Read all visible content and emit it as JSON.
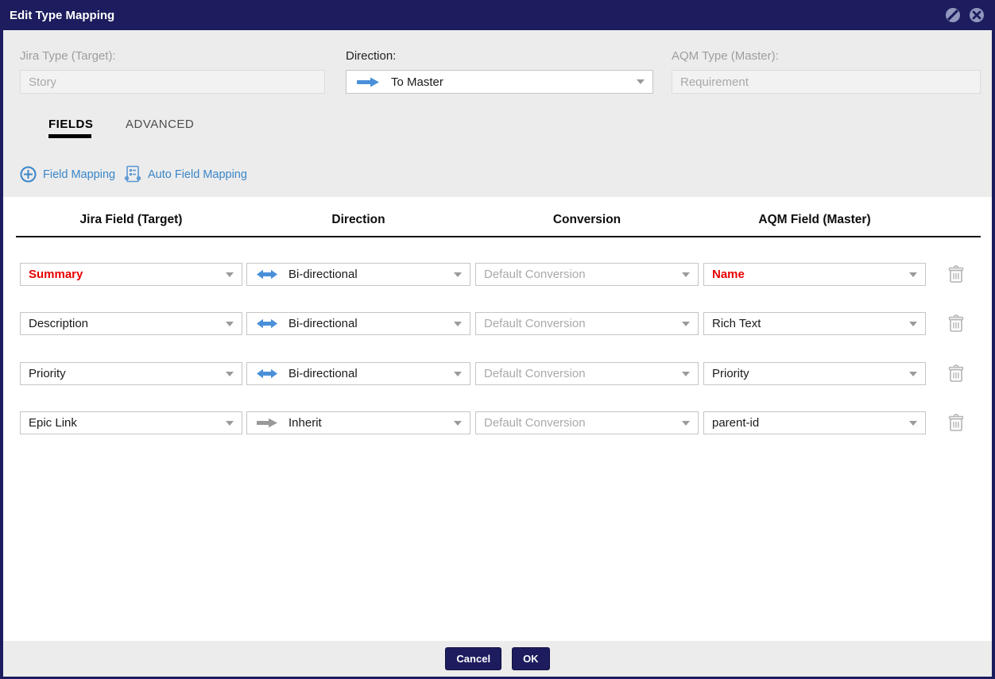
{
  "title_bar": {
    "title": "Edit Type Mapping",
    "icons": [
      "disable-circle-icon",
      "close-circle-icon"
    ]
  },
  "form": {
    "jira_type_label": "Jira Type (Target):",
    "jira_type_value": "Story",
    "direction_label": "Direction:",
    "direction_value": "To Master",
    "aqm_type_label": "AQM Type (Master):",
    "aqm_type_value": "Requirement"
  },
  "tabs": {
    "fields_label": "FIELDS",
    "advanced_label": "ADVANCED",
    "active_tab": "FIELDS"
  },
  "toolbar": {
    "field_mapping_label": "Field Mapping",
    "field_mapping_icon": "plus-circle-icon",
    "auto_field_mapping_label": "Auto Field Mapping",
    "auto_field_mapping_icon": "auto-mapping-document-icon"
  },
  "table": {
    "headers": {
      "jira_field": "Jira Field (Target)",
      "direction": "Direction",
      "conversion": "Conversion",
      "aqm_field": "AQM Field (Master)"
    },
    "rows": [
      {
        "jira_field": "Summary",
        "direction": "Bi-directional",
        "direction_type": "bi-directional",
        "conversion": "Default Conversion",
        "aqm_field": "Name",
        "highlighted": true
      },
      {
        "jira_field": "Description",
        "direction": "Bi-directional",
        "direction_type": "bi-directional",
        "conversion": "Default Conversion",
        "aqm_field": "Rich Text",
        "highlighted": false
      },
      {
        "jira_field": "Priority",
        "direction": "Bi-directional",
        "direction_type": "bi-directional",
        "conversion": "Default Conversion",
        "aqm_field": "Priority",
        "highlighted": false
      },
      {
        "jira_field": "Epic Link",
        "direction": "Inherit",
        "direction_type": "inherit",
        "conversion": "Default Conversion",
        "aqm_field": "parent-id",
        "highlighted": false
      }
    ],
    "row_action_icon": "trash-icon"
  },
  "footer": {
    "cancel_label": "Cancel",
    "ok_label": "OK"
  },
  "colors": {
    "title_bar_navy": "#1c1c5e",
    "accent_link_blue": "#3a86c8",
    "direction_arrow_blue": "#4a90d9",
    "inherit_arrow_gray": "#999999",
    "highlight_red": "#e80000",
    "section_gray": "#ececec",
    "disabled_text_gray": "#a8a8a8"
  }
}
